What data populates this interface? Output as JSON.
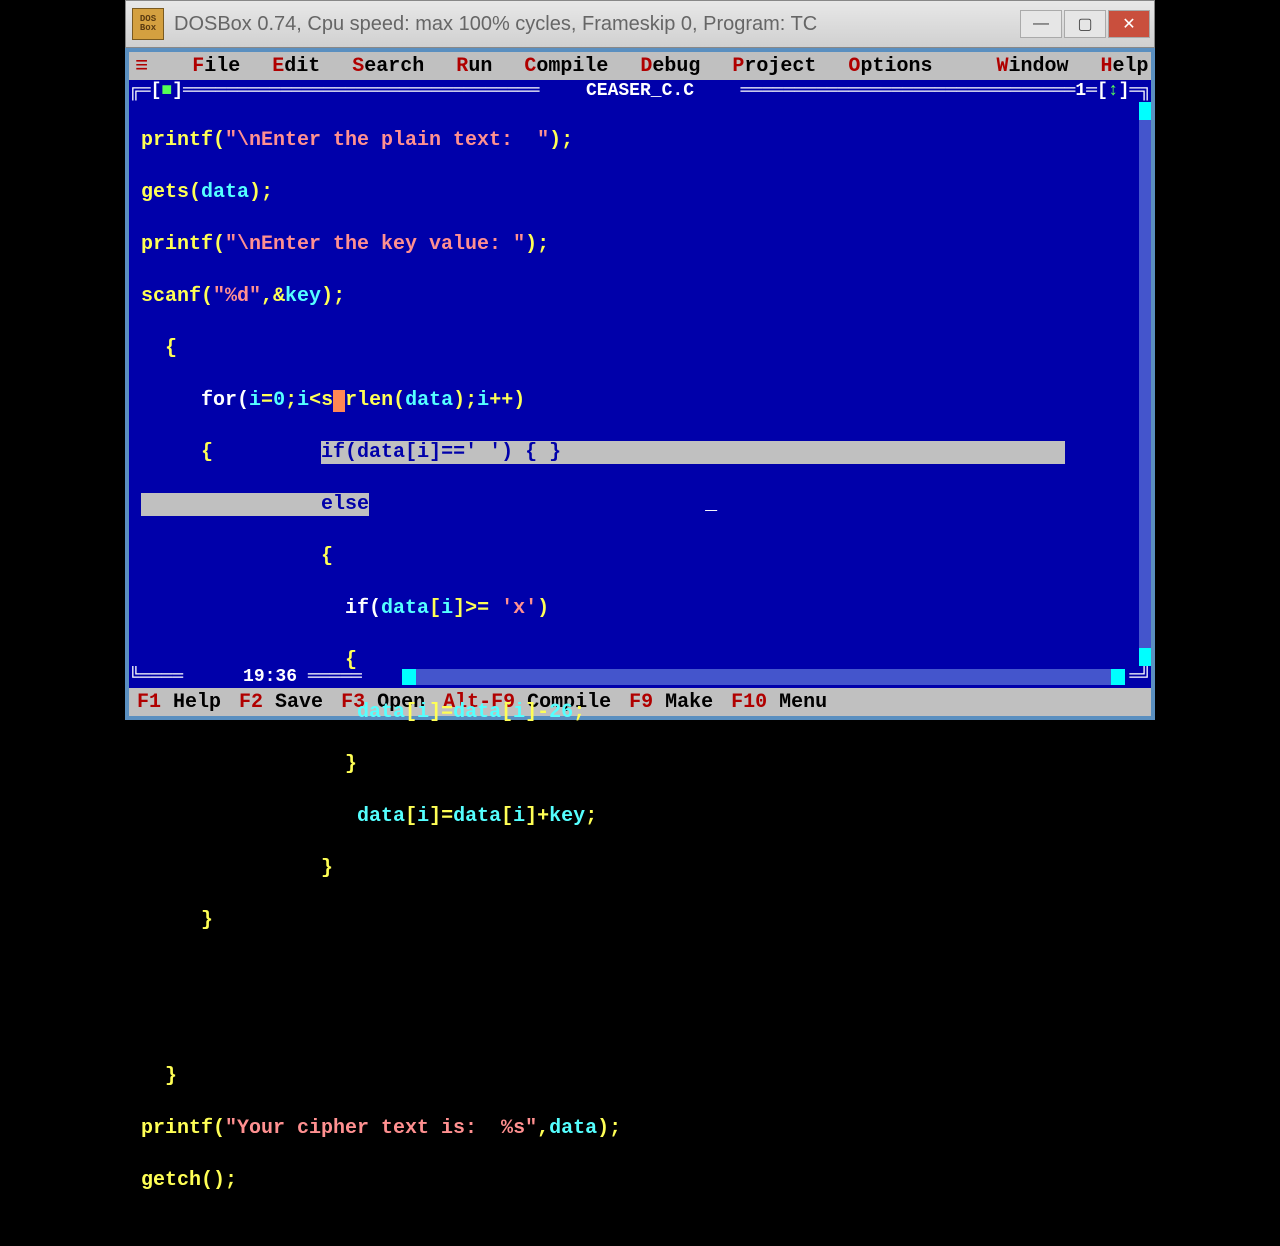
{
  "window": {
    "logo_top": "DOS",
    "logo_bot": "Box",
    "title": "DOSBox 0.74, Cpu speed: max 100% cycles, Frameskip  0, Program:     TC"
  },
  "menus": {
    "items": [
      {
        "hot": "F",
        "rest": "ile"
      },
      {
        "hot": "E",
        "rest": "dit"
      },
      {
        "hot": "S",
        "rest": "earch"
      },
      {
        "hot": "R",
        "rest": "un"
      },
      {
        "hot": "C",
        "rest": "ompile"
      },
      {
        "hot": "D",
        "rest": "ebug"
      },
      {
        "hot": "P",
        "rest": "roject"
      },
      {
        "hot": "O",
        "rest": "ptions"
      }
    ],
    "right": [
      {
        "hot": "W",
        "rest": "indow"
      },
      {
        "hot": "H",
        "rest": "elp"
      }
    ]
  },
  "editor": {
    "filename": " CEASER_C.C ",
    "window_num": "1",
    "cursor_pos": "19:36",
    "frame_left": "╔═[",
    "frame_close": "■",
    "frame_close2": "]═",
    "frame_fill": "══════════════════════════════",
    "frame_r1": "═",
    "frame_arrow": "",
    "frame_corner": "╗"
  },
  "code": {
    "l0a": "printf(",
    "l0b": "\"\\nEnter the plain text:  \"",
    "l0c": ");",
    "l1a": "gets(",
    "l1b": "data",
    "l1c": ");",
    "l2a": "printf(",
    "l2b": "\"\\nEnter the key value: \"",
    "l2c": ");",
    "l3a": "scanf(",
    "l3b": "\"%d\"",
    "l3c": ",&",
    "l3d": "key",
    "l3e": ");",
    "l4a": "  {",
    "l5a": "     for(",
    "l5b": "i",
    "l5c": "=",
    "l5d": "0",
    "l5e": ";",
    "l5f": "i",
    "l5g": "<s",
    "l5h": "rlen(",
    "l5i": "data",
    "l5j": ");",
    "l5k": "i",
    "l5l": "++)",
    "l6a": "     {         ",
    "l6b": "if(",
    "l6c": "data",
    "l6d": "[",
    "l6e": "i",
    "l6f": "]==",
    "l6g": "' '",
    "l6h": ") { }",
    "l7a": "               else",
    "l8a": "               {",
    "l9a": "                 if(",
    "l9b": "data",
    "l9c": "[",
    "l9d": "i",
    "l9e": "]>= ",
    "l9f": "'x'",
    "l9g": ")",
    "l10a": "                 {",
    "l11a": "                  ",
    "l11b": "data",
    "l11c": "[",
    "l11d": "i",
    "l11e": "]=",
    "l11f": "data",
    "l11g": "[",
    "l11h": "i",
    "l11i": "]-",
    "l11j": "26",
    "l11k": ";",
    "l12a": "                 }",
    "l13a": "                  ",
    "l13b": "data",
    "l13c": "[",
    "l13d": "i",
    "l13e": "]=",
    "l13f": "data",
    "l13g": "[",
    "l13h": "i",
    "l13i": "]+",
    "l13j": "key",
    "l13k": ";",
    "l14a": "               }",
    "l15a": "     }",
    "l16a": "",
    "l17a": "",
    "l18a": "  }",
    "l19a": "printf(",
    "l19b": "\"Your cipher text is:  %s\"",
    "l19c": ",",
    "l19d": "data",
    "l19e": ");",
    "l20a": "getch();"
  },
  "status": {
    "items": [
      {
        "key": "F1",
        "label": " Help"
      },
      {
        "key": "F2",
        "label": " Save"
      },
      {
        "key": "F3",
        "label": " Open"
      },
      {
        "key": "Alt-F9",
        "label": " Compile"
      },
      {
        "key": "F9",
        "label": " Make"
      },
      {
        "key": "F10",
        "label": " Menu"
      }
    ]
  }
}
